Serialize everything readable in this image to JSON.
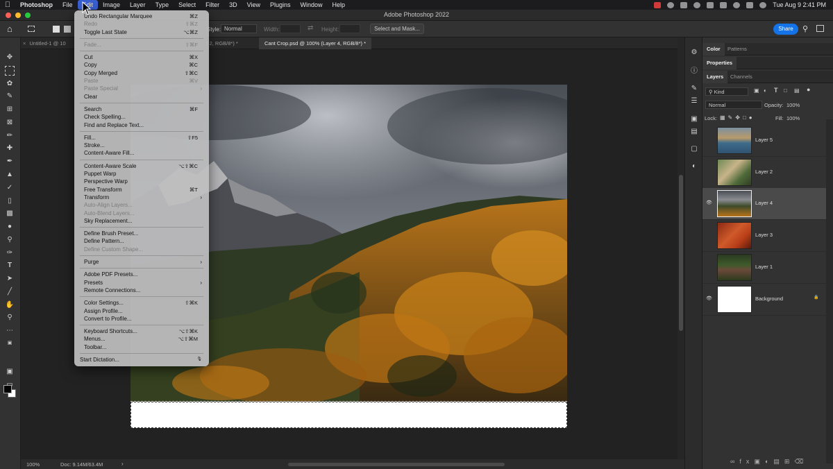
{
  "menubar": {
    "app": "Photoshop",
    "items": [
      "File",
      "Edit",
      "Image",
      "Layer",
      "Type",
      "Select",
      "Filter",
      "3D",
      "View",
      "Plugins",
      "Window",
      "Help"
    ],
    "clock": "Tue Aug 9  2:41 PM"
  },
  "window": {
    "title": "Adobe Photoshop 2022"
  },
  "options": {
    "style_label": "Style:",
    "style_value": "Normal",
    "width_label": "Width:",
    "height_label": "Height:",
    "mask_button": "Select and Mask...",
    "share_button": "Share"
  },
  "tabs": [
    {
      "label": "Untitled-1 @ 10"
    },
    {
      "label": "r 2, RGB/8*) *"
    },
    {
      "label": "Cant Crop.psd @ 100% (Layer 4, RGB/8*) *"
    }
  ],
  "edit_menu": {
    "groups": [
      [
        {
          "label": "Undo Rectangular Marquee",
          "shortcut": "⌘Z",
          "enabled": true
        },
        {
          "label": "Redo",
          "shortcut": "⇧⌘Z",
          "enabled": false
        },
        {
          "label": "Toggle Last State",
          "shortcut": "⌥⌘Z",
          "enabled": true
        }
      ],
      [
        {
          "label": "Fade...",
          "shortcut": "⇧⌘F",
          "enabled": false
        }
      ],
      [
        {
          "label": "Cut",
          "shortcut": "⌘X",
          "enabled": true
        },
        {
          "label": "Copy",
          "shortcut": "⌘C",
          "enabled": true
        },
        {
          "label": "Copy Merged",
          "shortcut": "⇧⌘C",
          "enabled": true
        },
        {
          "label": "Paste",
          "shortcut": "⌘V",
          "enabled": false
        },
        {
          "label": "Paste Special",
          "shortcut": "",
          "enabled": false,
          "submenu": true
        },
        {
          "label": "Clear",
          "shortcut": "",
          "enabled": true
        }
      ],
      [
        {
          "label": "Search",
          "shortcut": "⌘F",
          "enabled": true
        },
        {
          "label": "Check Spelling...",
          "shortcut": "",
          "enabled": true
        },
        {
          "label": "Find and Replace Text...",
          "shortcut": "",
          "enabled": true
        }
      ],
      [
        {
          "label": "Fill...",
          "shortcut": "⇧F5",
          "enabled": true
        },
        {
          "label": "Stroke...",
          "shortcut": "",
          "enabled": true
        },
        {
          "label": "Content-Aware Fill...",
          "shortcut": "",
          "enabled": true
        }
      ],
      [
        {
          "label": "Content-Aware Scale",
          "shortcut": "⌥⇧⌘C",
          "enabled": true
        },
        {
          "label": "Puppet Warp",
          "shortcut": "",
          "enabled": true
        },
        {
          "label": "Perspective Warp",
          "shortcut": "",
          "enabled": true
        },
        {
          "label": "Free Transform",
          "shortcut": "⌘T",
          "enabled": true
        },
        {
          "label": "Transform",
          "shortcut": "",
          "enabled": true,
          "submenu": true
        },
        {
          "label": "Auto-Align Layers...",
          "shortcut": "",
          "enabled": false
        },
        {
          "label": "Auto-Blend Layers...",
          "shortcut": "",
          "enabled": false
        },
        {
          "label": "Sky Replacement...",
          "shortcut": "",
          "enabled": true
        }
      ],
      [
        {
          "label": "Define Brush Preset...",
          "shortcut": "",
          "enabled": true
        },
        {
          "label": "Define Pattern...",
          "shortcut": "",
          "enabled": true
        },
        {
          "label": "Define Custom Shape...",
          "shortcut": "",
          "enabled": false
        }
      ],
      [
        {
          "label": "Purge",
          "shortcut": "",
          "enabled": true,
          "submenu": true
        }
      ],
      [
        {
          "label": "Adobe PDF Presets...",
          "shortcut": "",
          "enabled": true
        },
        {
          "label": "Presets",
          "shortcut": "",
          "enabled": true,
          "submenu": true
        },
        {
          "label": "Remote Connections...",
          "shortcut": "",
          "enabled": true
        }
      ],
      [
        {
          "label": "Color Settings...",
          "shortcut": "⇧⌘K",
          "enabled": true
        },
        {
          "label": "Assign Profile...",
          "shortcut": "",
          "enabled": true
        },
        {
          "label": "Convert to Profile...",
          "shortcut": "",
          "enabled": true
        }
      ],
      [
        {
          "label": "Keyboard Shortcuts...",
          "shortcut": "⌥⇧⌘K",
          "enabled": true
        },
        {
          "label": "Menus...",
          "shortcut": "⌥⇧⌘M",
          "enabled": true
        },
        {
          "label": "Toolbar...",
          "shortcut": "",
          "enabled": true
        }
      ]
    ],
    "dictation": "Start Dictation..."
  },
  "panels": {
    "top_tabs": [
      "Color",
      "Patterns"
    ],
    "properties": "Properties",
    "layer_tabs": [
      "Layers",
      "Channels"
    ],
    "filter_kind": "Kind",
    "blend_mode": "Normal",
    "opacity_label": "Opacity:",
    "opacity_value": "100%",
    "lock_label": "Lock:",
    "fill_label": "Fill:",
    "fill_value": "100%",
    "layers": [
      {
        "name": "Layer 5",
        "visible": false,
        "selected": false,
        "thumb": "lake"
      },
      {
        "name": "Layer 2",
        "visible": false,
        "selected": false,
        "thumb": "bird"
      },
      {
        "name": "Layer 4",
        "visible": true,
        "selected": true,
        "thumb": "mountain"
      },
      {
        "name": "Layer 3",
        "visible": false,
        "selected": false,
        "thumb": "red"
      },
      {
        "name": "Layer 1",
        "visible": false,
        "selected": false,
        "thumb": "dog"
      },
      {
        "name": "Background",
        "visible": true,
        "selected": false,
        "thumb": "white",
        "locked": true
      }
    ]
  },
  "status": {
    "zoom": "100%",
    "doc": "Doc: 9.14M/63.4M"
  },
  "colors": {
    "accent": "#1473e6",
    "menu_highlight": "#3a5fcf"
  }
}
